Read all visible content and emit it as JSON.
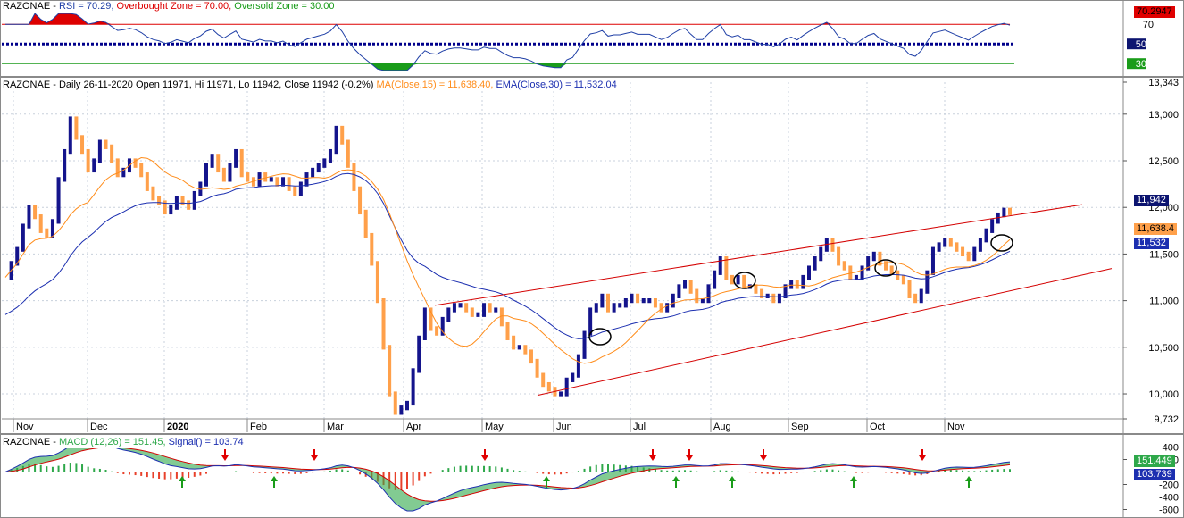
{
  "rsi": {
    "symbol": "RAZONAE",
    "label": "RSI = 70.29,",
    "ob_label": "Overbought Zone = 70.00,",
    "os_label": "Oversold Zone = 30.00",
    "value_badge": "70.2947",
    "ticks": [
      "70",
      "50",
      "30"
    ],
    "tick_values": [
      70,
      50,
      30
    ],
    "overbought": 70,
    "midline": 50,
    "oversold": 30,
    "range": [
      22,
      82
    ],
    "colors": {
      "line": "#1f3fa6",
      "ob": "#dd0000",
      "os": "#1a9c1a",
      "mid": "#00008b"
    }
  },
  "price": {
    "header_main": "RAZONAE - Daily 26-11-2020 Open 11971, Hi 11971, Lo 11942, Close 11942 (-0.2%)",
    "ma_label": "MA(Close,15) = 11,638.40,",
    "ema_label": "EMA(Close,30) = 11,532.04",
    "y_ticks": [
      "13,343",
      "13,000",
      "12,500",
      "12,000",
      "11,500",
      "11,000",
      "10,500",
      "10,000",
      "9,732"
    ],
    "y_tick_values": [
      13343,
      13000,
      12500,
      12000,
      11500,
      11000,
      10500,
      10000,
      9732
    ],
    "badges": {
      "close": "11,942",
      "ma": "11,638.4",
      "ema": "11,532"
    },
    "x_labels": [
      "Nov",
      "Dec",
      "2020",
      "Feb",
      "Mar",
      "Apr",
      "May",
      "Jun",
      "Jul",
      "Aug",
      "Sep",
      "Oct",
      "Nov"
    ],
    "colors": {
      "up": "#14148c",
      "down": "#ffa04a",
      "ma": "#ff8c1a",
      "ema": "#1c2fb0",
      "trend": "#d40000"
    }
  },
  "macd": {
    "symbol": "RAZONAE",
    "label": "MACD (12,26) = 151.45,",
    "signal_label": "Signal() = 103.74",
    "ticks": [
      "400",
      "200",
      "-200",
      "-400",
      "-600"
    ],
    "tick_values": [
      400,
      200,
      -200,
      -400,
      -600
    ],
    "badges": {
      "macd": "151.449",
      "signal": "103.739"
    },
    "colors": {
      "macd": "#1c2fb0",
      "signal": "#d40000",
      "pos": "#2ea84a",
      "neg": "#e8402a"
    }
  },
  "chart_data": {
    "type": "candlestick",
    "symbol": "RAZONAE",
    "interval": "Daily",
    "date_range": [
      "Nov 2019",
      "26-11-2020"
    ],
    "last_bar": {
      "date": "26-11-2020",
      "open": 11971,
      "high": 11971,
      "low": 11942,
      "close": 11942,
      "change_pct": -0.2
    },
    "indicators": {
      "ma_close_15": 11638.4,
      "ema_close_30": 11532.04,
      "rsi": 70.29,
      "macd": 151.45,
      "macd_signal": 103.74
    },
    "ylim": [
      9732,
      13343
    ],
    "closes": [
      11250,
      11400,
      11550,
      11800,
      12000,
      11900,
      11750,
      11700,
      11850,
      12300,
      12600,
      12950,
      12750,
      12600,
      12400,
      12500,
      12700,
      12650,
      12500,
      12350,
      12400,
      12500,
      12450,
      12350,
      12200,
      12100,
      12050,
      11950,
      12000,
      12100,
      12050,
      12000,
      12150,
      12250,
      12450,
      12550,
      12400,
      12300,
      12450,
      12600,
      12350,
      12300,
      12250,
      12350,
      12300,
      12300,
      12250,
      12300,
      12200,
      12150,
      12250,
      12350,
      12400,
      12450,
      12500,
      12600,
      12850,
      12700,
      12450,
      12200,
      11950,
      11700,
      11400,
      11000,
      10500,
      10000,
      9800,
      9850,
      9900,
      10250,
      10600,
      10900,
      10700,
      10650,
      10800,
      10900,
      10950,
      10950,
      10900,
      10850,
      10850,
      10950,
      10900,
      10900,
      10750,
      10600,
      10500,
      10500,
      10450,
      10350,
      10200,
      10100,
      10050,
      10000,
      10000,
      10150,
      10200,
      10400,
      10650,
      10900,
      10950,
      11050,
      10900,
      10950,
      10950,
      11000,
      11050,
      11000,
      11000,
      11000,
      10950,
      10900,
      10950,
      11050,
      11150,
      11200,
      11100,
      11000,
      11000,
      11150,
      11300,
      11450,
      11250,
      11200,
      11250,
      11150,
      11150,
      11100,
      11050,
      11050,
      11000,
      11050,
      11150,
      11200,
      11150,
      11250,
      11350,
      11450,
      11550,
      11650,
      11550,
      11400,
      11350,
      11250,
      11250,
      11350,
      11450,
      11500,
      11400,
      11350,
      11300,
      11250,
      11200,
      11050,
      11000,
      11100,
      11300,
      11550,
      11600,
      11650,
      11600,
      11550,
      11500,
      11450,
      11550,
      11650,
      11750,
      11850,
      11920,
      11971,
      11942
    ],
    "x_labels": [
      "Nov",
      "Dec",
      "2020",
      "Feb",
      "Mar",
      "Apr",
      "May",
      "Jun",
      "Jul",
      "Aug",
      "Sep",
      "Oct",
      "Nov"
    ],
    "trendlines": {
      "upper": [
        {
          "date": "Apr 2020",
          "value": 10950
        },
        {
          "date": "Dec 2020",
          "value": 12030
        }
      ],
      "lower": [
        {
          "date": "May 2020",
          "value": 9985
        },
        {
          "date": "Dec 2020",
          "value": 11345
        }
      ]
    },
    "rsi_levels": {
      "overbought": 70,
      "midline": 50,
      "oversold": 30
    },
    "macd_ylim": [
      -650,
      450
    ]
  }
}
